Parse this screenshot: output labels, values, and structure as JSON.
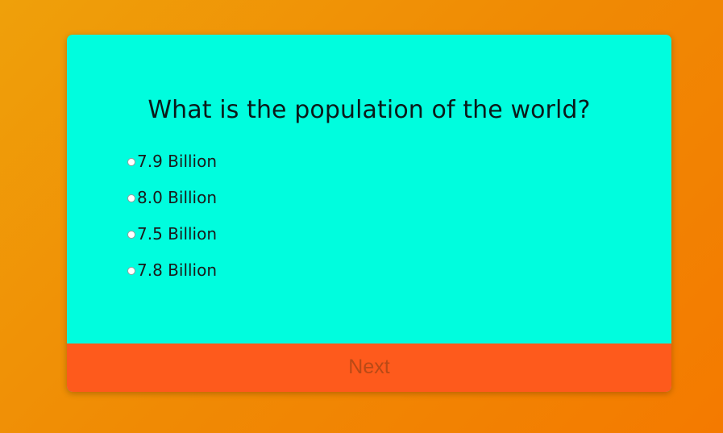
{
  "quiz": {
    "question": "What is the population of the world?",
    "answers": [
      {
        "label": "7.9 Billion"
      },
      {
        "label": "8.0 Billion"
      },
      {
        "label": "7.5 Billion"
      },
      {
        "label": "7.8 Billion"
      }
    ],
    "next_label": "Next"
  },
  "colors": {
    "background_gradient_start": "#efa00a",
    "background_gradient_end": "#f47a00",
    "card_background": "#00fdde",
    "next_button_background": "#fe5a1c",
    "next_button_text": "#b94a16"
  }
}
